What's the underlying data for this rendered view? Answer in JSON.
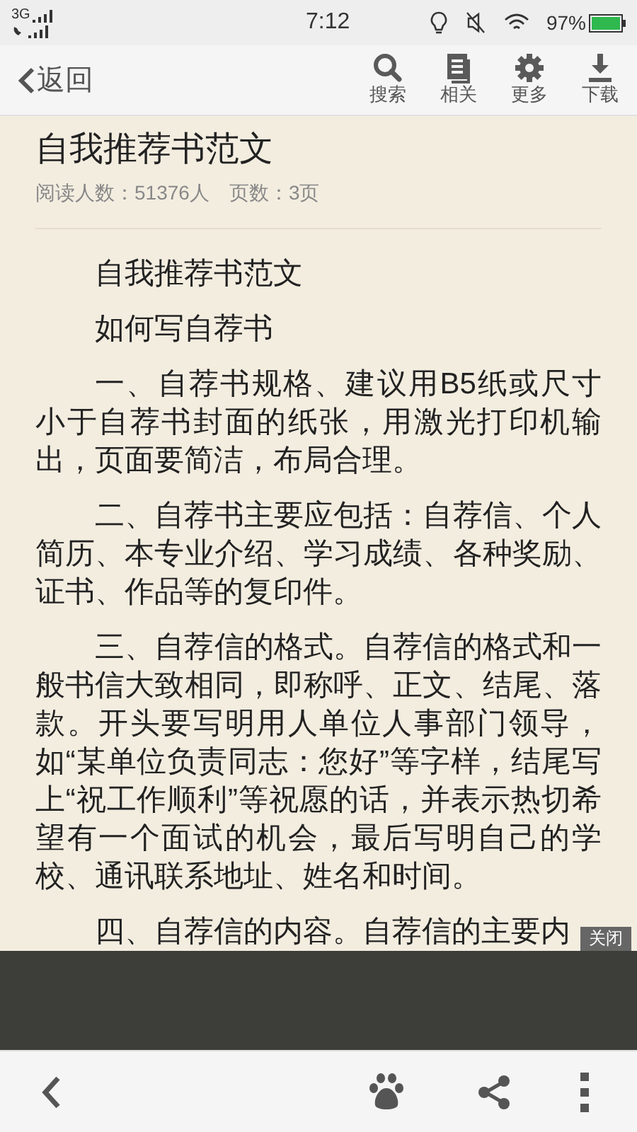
{
  "status_bar": {
    "network": "3G",
    "time": "7:12",
    "battery": "97%"
  },
  "toolbar": {
    "back": "返回",
    "actions": [
      {
        "kind": "search",
        "label": "搜索"
      },
      {
        "kind": "related",
        "label": "相关"
      },
      {
        "kind": "more",
        "label": "更多"
      },
      {
        "kind": "download",
        "label": "下载"
      }
    ]
  },
  "document": {
    "title": "自我推荐书范文",
    "meta": [
      "阅读人数：51376人",
      "页数：3页"
    ],
    "paragraphs": [
      "自我推荐书范文",
      "如何写自荐书",
      "一、自荐书规格、建议用B5纸或尺寸小于自荐书封面的纸张，用激光打印机输出，页面要简洁，布局合理。",
      "二、自荐书主要应包括：自荐信、个人简历、本专业介绍、学习成绩、各种奖励、证书、作品等的复印件。",
      "三、自荐信的格式。自荐信的格式和一般书信大致相同，即称呼、正文、结尾、落款。开头要写明用人单位人事部门领导，如“某单位负责同志：您好”等字样，结尾写上“祝工作顺利”等祝愿的话，并表示热切希望有一个面试的机会，最后写明自己的学校、通讯联系地址、姓名和时间。",
      "四、自荐信的内容。自荐信的主要内"
    ]
  },
  "overlay": {
    "close": "关闭"
  }
}
